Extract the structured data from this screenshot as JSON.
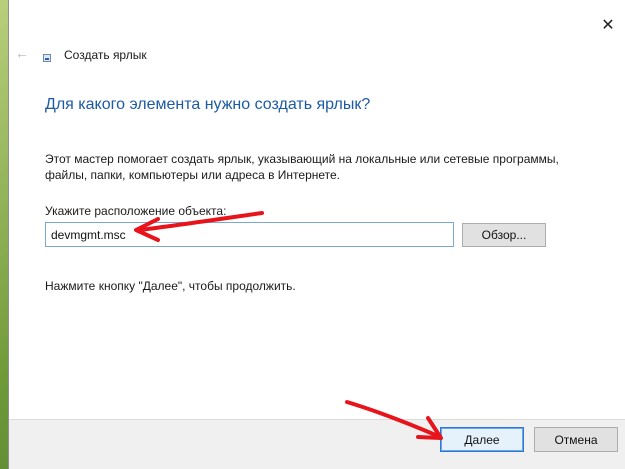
{
  "wizard": {
    "title": "Создать ярлык",
    "heading": "Для какого элемента нужно создать ярлык?",
    "description": "Этот мастер помогает создать ярлык, указывающий на локальные или сетевые программы, файлы, папки, компьютеры или адреса в Интернете.",
    "location_label": "Укажите расположение объекта:",
    "location_value": "devmgmt.msc",
    "browse_label": "Обзор...",
    "hint": "Нажмите кнопку \"Далее\", чтобы продолжить.",
    "next_label": "Далее",
    "cancel_label": "Отмена",
    "close_glyph": "✕",
    "back_glyph": "←"
  },
  "icons": {
    "back": "back-arrow-icon",
    "close": "close-icon",
    "wizard": "shortcut-wizard-icon",
    "annotation": "red-arrow-icon"
  },
  "colors": {
    "heading": "#1c5aa6",
    "annotation_arrow": "#e8141c",
    "default_button_border": "#2a78d7"
  }
}
